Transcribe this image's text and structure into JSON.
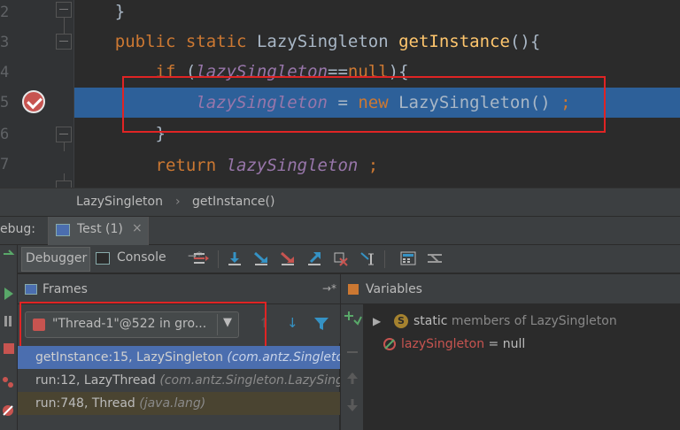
{
  "editor": {
    "line_numbers": [
      "2",
      "3",
      "4",
      "5",
      "6",
      "7"
    ],
    "lines": [
      {
        "indent": "    ",
        "tokens": [
          {
            "t": "}",
            "c": "plain"
          }
        ]
      },
      {
        "indent": "    ",
        "tokens": [
          {
            "t": "public",
            "c": "kw"
          },
          {
            "t": " ",
            "c": "plain"
          },
          {
            "t": "static",
            "c": "kw"
          },
          {
            "t": " LazySingleton ",
            "c": "plain"
          },
          {
            "t": "getInstance",
            "c": "mth"
          },
          {
            "t": "(){",
            "c": "plain"
          }
        ]
      },
      {
        "indent": "        ",
        "tokens": [
          {
            "t": "if",
            "c": "kw"
          },
          {
            "t": " (",
            "c": "plain"
          },
          {
            "t": "lazySingleton",
            "c": "fld"
          },
          {
            "t": "==",
            "c": "plain"
          },
          {
            "t": "null",
            "c": "kw"
          },
          {
            "t": "){",
            "c": "plain"
          }
        ]
      },
      {
        "indent": "            ",
        "tokens": [
          {
            "t": "lazySingleton",
            "c": "fld"
          },
          {
            "t": " = ",
            "c": "plain"
          },
          {
            "t": "new",
            "c": "kw"
          },
          {
            "t": " LazySingleton() ",
            "c": "plain"
          },
          {
            "t": ";",
            "c": "kw"
          }
        ]
      },
      {
        "indent": "        ",
        "tokens": [
          {
            "t": "}",
            "c": "plain"
          }
        ]
      },
      {
        "indent": "        ",
        "tokens": [
          {
            "t": "return",
            "c": "kw"
          },
          {
            "t": " ",
            "c": "plain"
          },
          {
            "t": "lazySingleton",
            "c": "fld"
          },
          {
            "t": " ",
            "c": "plain"
          },
          {
            "t": ";",
            "c": "kw"
          }
        ]
      }
    ]
  },
  "breadcrumb": {
    "items": [
      "LazySingleton",
      "getInstance()"
    ],
    "separator": "›"
  },
  "debug_window": {
    "label": "ebug:",
    "tab_label": "Test (1)",
    "tab_close": "×"
  },
  "toolbar": {
    "debugger_tab": "Debugger",
    "console_tab": "Console",
    "pin": "→*"
  },
  "frames": {
    "title": "Frames",
    "pin": "→*",
    "thread_selected": "\"Thread-1\"@522 in gro...",
    "thread_arrow": "▼",
    "rows": [
      {
        "method": "getInstance:15, LazySingleton ",
        "pkg": "(com.antz.Singleton.LazySingleton)",
        "state": "selected"
      },
      {
        "method": "run:12, LazyThread ",
        "pkg": "(com.antz.Singleton.LazySingleton)",
        "state": "normal"
      },
      {
        "method": "run:748, Thread ",
        "pkg": "(java.lang)",
        "state": "other"
      }
    ]
  },
  "variables": {
    "title": "Variables",
    "rows": [
      {
        "toggle": "▶",
        "icon": "S",
        "prefix": "static",
        "text": " members of LazySingleton"
      },
      {
        "name": "lazySingleton",
        "value": " = null"
      }
    ]
  },
  "colors": {
    "execution_line": "#2d6099",
    "annotation_box": "#e02424",
    "selected_frame": "#4b6eaf"
  }
}
